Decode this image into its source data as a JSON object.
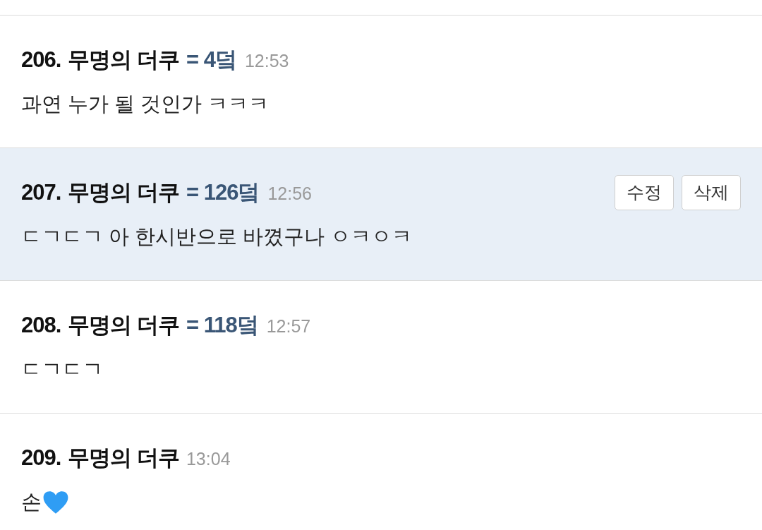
{
  "comments": [
    {
      "number": "206.",
      "author": "무명의 더쿠",
      "score": "= 4덬",
      "time": "12:53",
      "text": "과연 누가 될 것인가 ㅋㅋㅋ",
      "selected": false,
      "heart": false
    },
    {
      "number": "207.",
      "author": "무명의 더쿠",
      "score": "= 126덬",
      "time": "12:56",
      "text": "ㄷㄱㄷㄱ 아 한시반으로 바꼈구나 ㅇㅋㅇㅋ",
      "selected": true,
      "heart": false,
      "actions": [
        "수정",
        "삭제"
      ]
    },
    {
      "number": "208.",
      "author": "무명의 더쿠",
      "score": "= 118덬",
      "time": "12:57",
      "text": "ㄷㄱㄷㄱ",
      "selected": false,
      "heart": false
    },
    {
      "number": "209.",
      "author": "무명의 더쿠",
      "time": "13:04",
      "text": "손",
      "selected": false,
      "heart": true
    }
  ]
}
